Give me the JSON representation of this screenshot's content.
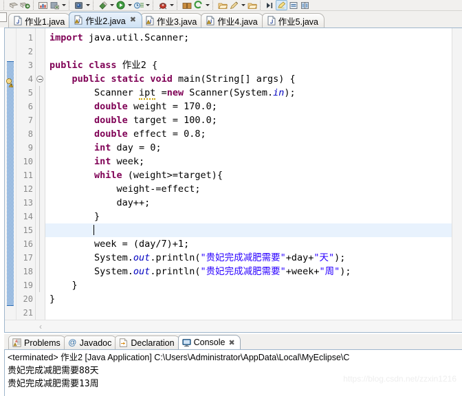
{
  "toolbar": {
    "items": [
      {
        "name": "save-button",
        "icon": "save-icon"
      },
      {
        "name": "save-all-button",
        "icon": "save-all-icon"
      },
      {
        "name": "print-button",
        "icon": "chart-icon"
      },
      {
        "name": "export-button",
        "icon": "export-icon"
      },
      {
        "name": "debug-button",
        "icon": "debug-bug-icon"
      },
      {
        "name": "run-button",
        "icon": "run-green-icon"
      },
      {
        "name": "run-history-button",
        "icon": "run-history-icon"
      },
      {
        "name": "external-tools-button",
        "icon": "toolbox-icon"
      },
      {
        "name": "open-type-button",
        "icon": "book-icon"
      },
      {
        "name": "search-button",
        "icon": "search-green-icon"
      },
      {
        "name": "new-folder-button",
        "icon": "folder-icon"
      },
      {
        "name": "new-java-button",
        "icon": "pencil-icon"
      },
      {
        "name": "open-resource-button",
        "icon": "folder2-icon"
      },
      {
        "name": "next-annotation-button",
        "icon": "next-arrow-icon"
      },
      {
        "name": "toggle-mark-button",
        "icon": "highlighter-icon"
      },
      {
        "name": "toggle-block-button",
        "icon": "block-icon"
      },
      {
        "name": "toggle-split-button",
        "icon": "split-icon"
      }
    ]
  },
  "editor_tabs": [
    {
      "label": "作业1.java",
      "icon": "java-file-icon",
      "active": false,
      "closable": false,
      "warning": false
    },
    {
      "label": "作业2.java",
      "icon": "java-file-warning-icon",
      "active": true,
      "closable": true,
      "warning": true
    },
    {
      "label": "作业3.java",
      "icon": "java-file-warning-icon",
      "active": false,
      "closable": false,
      "warning": true
    },
    {
      "label": "作业4.java",
      "icon": "java-file-warning-icon",
      "active": false,
      "closable": false,
      "warning": true
    },
    {
      "label": "作业5.java",
      "icon": "java-file-icon",
      "active": false,
      "closable": false,
      "warning": false
    }
  ],
  "editor": {
    "current_line": 15,
    "warning_marker_line": 5,
    "fold_marker_line": 4,
    "lines": [
      {
        "n": 1,
        "html": "<span class=\"kw\">import</span> java.util.Scanner;"
      },
      {
        "n": 2,
        "html": ""
      },
      {
        "n": 3,
        "html": "<span class=\"kw\">public</span> <span class=\"kw\">class</span> 作业2 {"
      },
      {
        "n": 4,
        "html": "    <span class=\"kw\">public</span> <span class=\"kw\">static</span> <span class=\"kw\">void</span> main(String[] args) {"
      },
      {
        "n": 5,
        "html": "        Scanner <span class=\"squiggle\">ipt</span> =<span class=\"kw\">new</span> Scanner(System.<span class=\"fld\">in</span>);"
      },
      {
        "n": 6,
        "html": "        <span class=\"kw\">double</span> weight = 170.0;"
      },
      {
        "n": 7,
        "html": "        <span class=\"kw\">double</span> target = 100.0;"
      },
      {
        "n": 8,
        "html": "        <span class=\"kw\">double</span> effect = 0.8;"
      },
      {
        "n": 9,
        "html": "        <span class=\"kw\">int</span> day = 0;"
      },
      {
        "n": 10,
        "html": "        <span class=\"kw\">int</span> week;"
      },
      {
        "n": 11,
        "html": "        <span class=\"kw\">while</span> (weight&gt;=target){"
      },
      {
        "n": 12,
        "html": "            weight-=effect;"
      },
      {
        "n": 13,
        "html": "            day++;"
      },
      {
        "n": 14,
        "html": "        }"
      },
      {
        "n": 15,
        "html": "        <span class=\"cursor\"></span>"
      },
      {
        "n": 16,
        "html": "        week = (day/7)+1;"
      },
      {
        "n": 17,
        "html": "        System.<span class=\"fld\">out</span>.println(<span class=\"str\">\"贵妃完成减肥需要\"</span>+day+<span class=\"str\">\"天\"</span>);"
      },
      {
        "n": 18,
        "html": "        System.<span class=\"fld\">out</span>.println(<span class=\"str\">\"贵妃完成减肥需要\"</span>+week+<span class=\"str\">\"周\"</span>);"
      },
      {
        "n": 19,
        "html": "    }"
      },
      {
        "n": 20,
        "html": "}"
      },
      {
        "n": 21,
        "html": ""
      }
    ],
    "footer_chevron": "‹"
  },
  "bottom_tabs": [
    {
      "label": "Problems",
      "icon": "problems-icon",
      "active": false,
      "closable": false
    },
    {
      "label": "Javadoc",
      "icon": "javadoc-at-icon",
      "active": false,
      "closable": false
    },
    {
      "label": "Declaration",
      "icon": "declaration-icon",
      "active": false,
      "closable": false
    },
    {
      "label": "Console",
      "icon": "console-monitor-icon",
      "active": true,
      "closable": true
    }
  ],
  "console": {
    "header": "<terminated> 作业2 [Java Application] C:\\Users\\Administrator\\AppData\\Local\\MyEclipse\\C",
    "output": [
      "贵妃完成减肥需要88天",
      "贵妃完成减肥需要13周"
    ]
  },
  "watermark": "https://blog.csdn.net/zzxin1216",
  "colors": {
    "keyword": "#7f0055",
    "string": "#2a00ff",
    "field": "#0000c0",
    "current_line_bg": "#e8f2fd",
    "tab_active_bg": "#cfe2f4",
    "change_bar": "#3b7cc4"
  }
}
